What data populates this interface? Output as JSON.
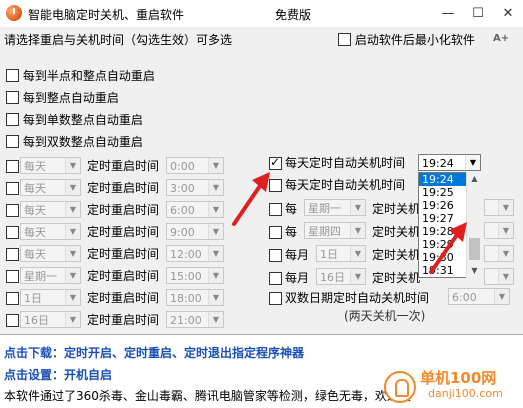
{
  "window": {
    "title": "智能电脑定时关机、重启软件",
    "center_title": "免费版",
    "minimize": "—",
    "maximize": "☐",
    "close": "✕"
  },
  "header": {
    "instruction": "请选择重启与关机时间（勾选生效）可多选",
    "minimize_on_start_label": "启动软件后最小化软件",
    "font_size_icon": "A+"
  },
  "restart_options": [
    {
      "label": "每到半点和整点自动重启",
      "checked": false
    },
    {
      "label": "每到整点自动重启",
      "checked": false
    },
    {
      "label": "每到单数整点自动重启",
      "checked": false
    },
    {
      "label": "每到双数整点自动重启",
      "checked": false
    }
  ],
  "timed_restart_label": "定时重启时间",
  "timed_restart_rows": [
    {
      "period": "每天",
      "time": "0:00"
    },
    {
      "period": "每天",
      "time": "3:00"
    },
    {
      "period": "每天",
      "time": "6:00"
    },
    {
      "period": "每天",
      "time": "9:00"
    },
    {
      "period": "每天",
      "time": "12:00"
    },
    {
      "period": "星期一",
      "time": "15:00"
    },
    {
      "period": "1日",
      "time": "18:00"
    },
    {
      "period": "16日",
      "time": "21:00"
    }
  ],
  "shutdown": {
    "daily_label": "每天定时自动关机时间",
    "daily_checked": true,
    "daily_time": "19:24",
    "daily2_label": "每天定时自动关机时间",
    "weekly1_prefix": "每",
    "weekly1_period": "星期一",
    "weekly1_label": "定时关机",
    "weekly2_prefix": "每",
    "weekly2_period": "星期四",
    "weekly2_label": "定时关机",
    "monthly1_prefix": "每月",
    "monthly1_period": "1日",
    "monthly1_label": "定时关机",
    "monthly2_prefix": "每月",
    "monthly2_period": "16日",
    "monthly2_label": "定时关机",
    "double_label": "双数日期定时自动关机时间",
    "double_time": "6:00",
    "double_note": "(两天关机一次)"
  },
  "time_list": {
    "items": [
      "19:24",
      "19:25",
      "19:26",
      "19:27",
      "19:28",
      "19:29",
      "19:30",
      "19:31"
    ],
    "selected": "19:24"
  },
  "bottom": {
    "download_link": "点击下载：定时开启、定时重启、定时退出指定程序神器",
    "settings_link": "点击设置：开机自启",
    "note": "本软件通过了360杀毒、金山毒霸、腾讯电脑管家等检测，绿色无毒，欢迎使"
  },
  "watermark": {
    "line1": "单机100网",
    "line2": "danji100.com"
  },
  "colors": {
    "link_blue": "#1a4fb8",
    "selection_blue": "#0078d7",
    "arrow_red": "#e02020",
    "watermark_orange": "#f08a2a"
  }
}
